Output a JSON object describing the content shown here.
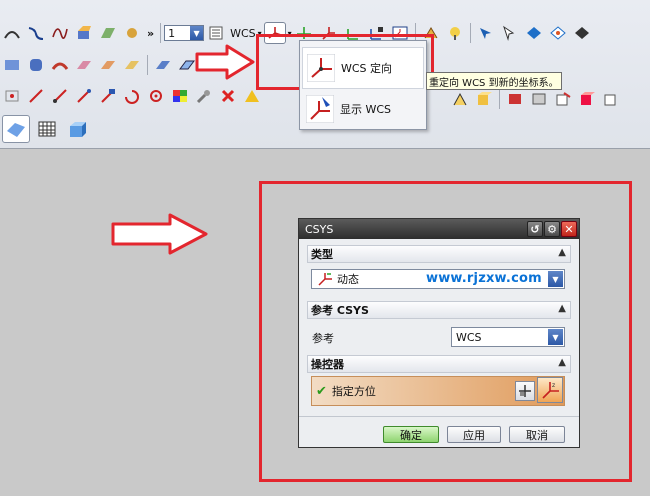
{
  "toolbar": {
    "layer_value": "1",
    "wcs_label": "WCS",
    "overflow_chevron": "»"
  },
  "wcs_menu": {
    "items": [
      {
        "label": "WCS 定向",
        "icon": "wcs-orient-icon"
      },
      {
        "label": "显示 WCS",
        "icon": "wcs-display-icon"
      }
    ]
  },
  "tooltip": {
    "text": "重定向 WCS 到新的坐标系。"
  },
  "dialog": {
    "title": "CSYS",
    "sections": {
      "type": {
        "header": "类型",
        "value": "动态"
      },
      "ref": {
        "header": "参考 CSYS",
        "label": "参考",
        "value": "WCS"
      },
      "manip": {
        "header": "操控器",
        "specify_label": "指定方位"
      }
    },
    "watermark": "www.rjzxw.com",
    "buttons": {
      "ok": "确定",
      "apply": "应用",
      "cancel": "取消"
    }
  },
  "colors": {
    "highlight_red": "#e3262e",
    "ok_green": "#8fd470",
    "watermark_blue": "#0a72d6"
  }
}
